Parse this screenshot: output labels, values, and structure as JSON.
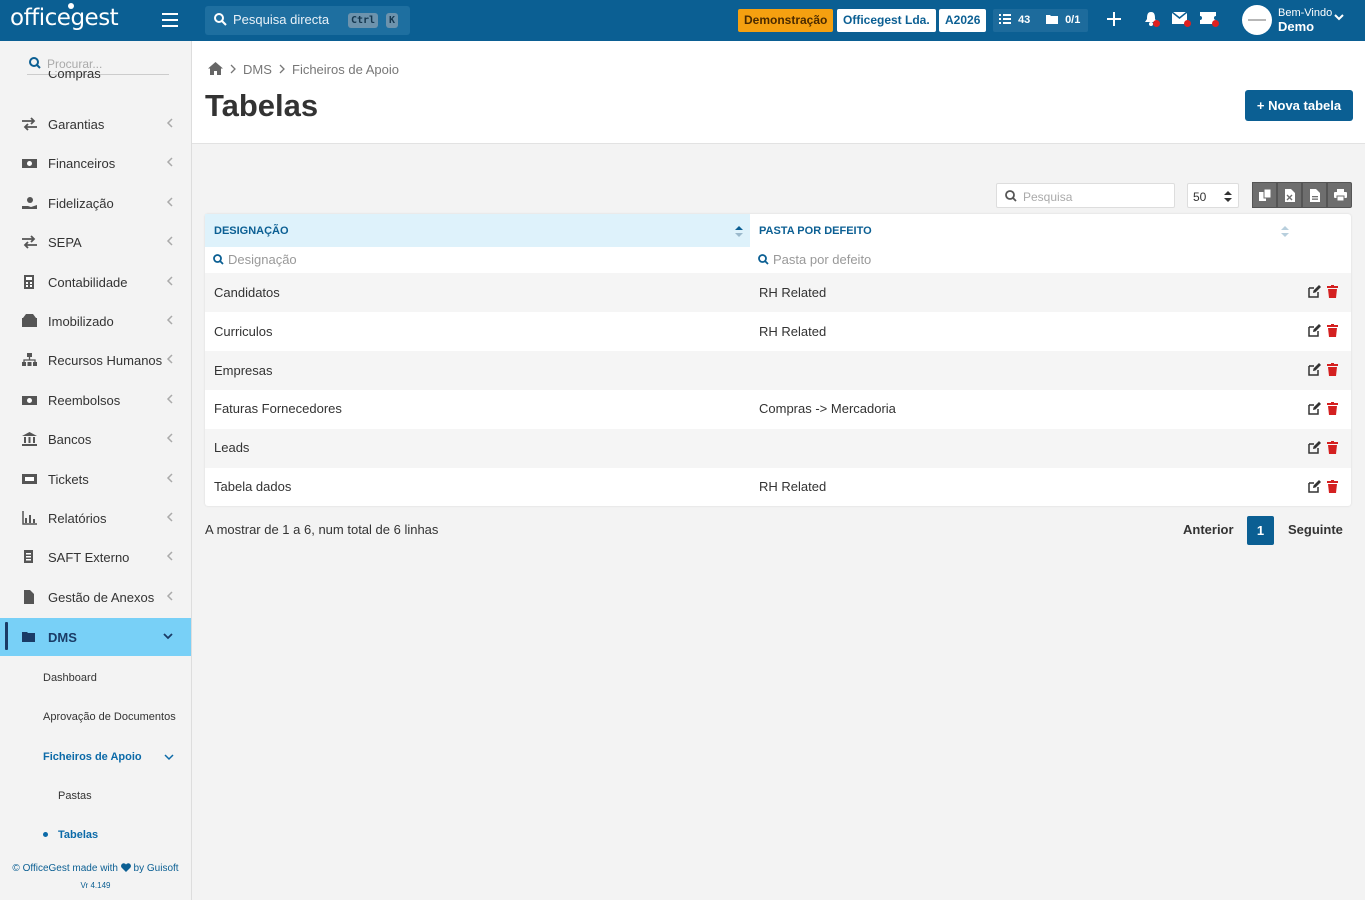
{
  "app": {
    "logo": "officegest"
  },
  "topbar": {
    "search_label": "Pesquisa directa",
    "kbd_ctrl": "Ctrl",
    "kbd_k": "K",
    "demo_badge": "Demonstração",
    "company": "Officegest Lda.",
    "year": "A2026",
    "tasks_count": "43",
    "docs_count": "0/1",
    "welcome": "Bem-Vindo",
    "user": "Demo"
  },
  "sidebar": {
    "search_placeholder": "Procurar...",
    "partial_item": "Compras",
    "items": [
      {
        "label": "Garantias",
        "icon": "exchange-icon"
      },
      {
        "label": "Financeiros",
        "icon": "money-icon"
      },
      {
        "label": "Fidelização",
        "icon": "hand-holding-icon"
      },
      {
        "label": "SEPA",
        "icon": "exchange-icon"
      },
      {
        "label": "Contabilidade",
        "icon": "calculator-icon"
      },
      {
        "label": "Imobilizado",
        "icon": "boxes-icon"
      },
      {
        "label": "Recursos Humanos",
        "icon": "sitemap-icon"
      },
      {
        "label": "Reembolsos",
        "icon": "money-icon"
      },
      {
        "label": "Bancos",
        "icon": "bank-icon"
      },
      {
        "label": "Tickets",
        "icon": "ticket-icon"
      },
      {
        "label": "Relatórios",
        "icon": "chart-icon"
      },
      {
        "label": "SAFT Externo",
        "icon": "file-code-icon"
      },
      {
        "label": "Gestão de Anexos",
        "icon": "file-icon"
      }
    ],
    "active_item": "DMS",
    "sub_items": {
      "dashboard": "Dashboard",
      "approval": "Aprovação de Documentos",
      "support_files": "Ficheiros de Apoio",
      "folders": "Pastas",
      "tables": "Tabelas"
    },
    "footer_text": "© OfficeGest made with",
    "footer_by": "by Guisoft",
    "version": "Vr 4.149"
  },
  "breadcrumb": {
    "level1": "DMS",
    "level2": "Ficheiros de Apoio"
  },
  "page": {
    "title": "Tabelas",
    "new_button": "+ Nova tabela"
  },
  "toolbar": {
    "search_placeholder": "Pesquisa",
    "page_size": "50"
  },
  "table": {
    "columns": [
      "DESIGNAÇÃO",
      "PASTA POR DEFEITO"
    ],
    "filters": [
      "Designação",
      "Pasta por defeito"
    ],
    "rows": [
      [
        "Candidatos",
        "RH Related"
      ],
      [
        "Curriculos",
        "RH Related"
      ],
      [
        "Empresas",
        ""
      ],
      [
        "Faturas Fornecedores",
        "Compras -> Mercadoria"
      ],
      [
        "Leads",
        ""
      ],
      [
        "Tabela dados",
        "RH Related"
      ]
    ]
  },
  "pagination": {
    "info": "A mostrar de 1 a 6, num total de 6 linhas",
    "prev": "Anterior",
    "current": "1",
    "next": "Seguinte"
  },
  "colors": {
    "brand": "#0b5f93",
    "accent": "#78d0f7",
    "warning": "#f5a010",
    "danger": "#d42020"
  }
}
